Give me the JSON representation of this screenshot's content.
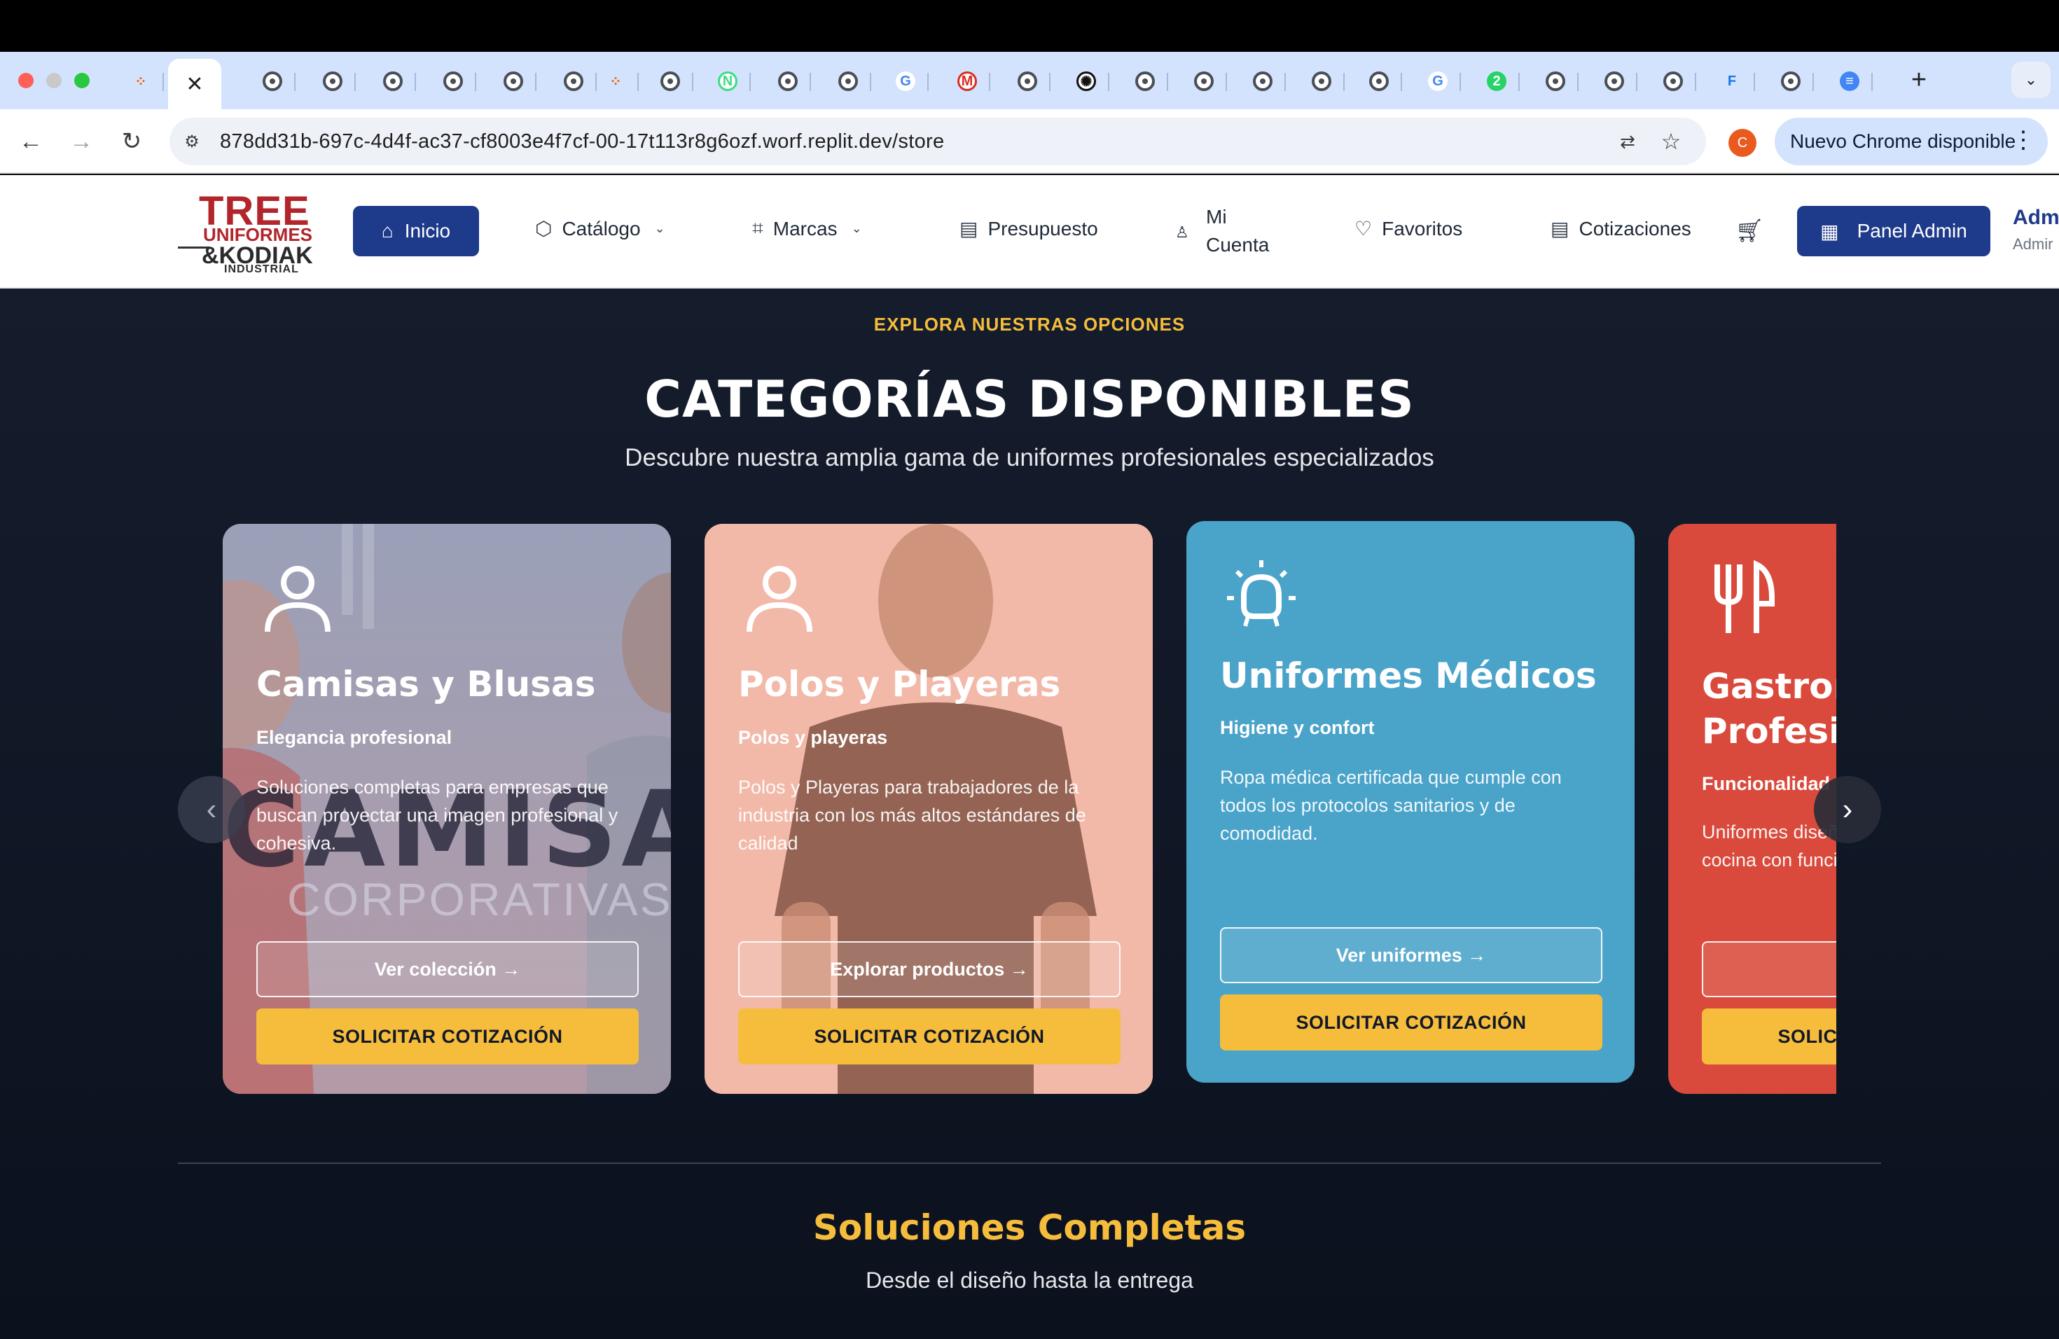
{
  "browser": {
    "active_tab_close": "✕",
    "new_tab": "+",
    "tab_menu": "⌄",
    "url": "878dd31b-697c-4d4f-ac37-cf8003e4f7cf-00-17t113r8g6ozf.worf.replit.dev/store",
    "profile_initial": "C",
    "update_label": "Nuevo Chrome disponible",
    "tabs": [
      {
        "icon": "replit-icon",
        "glyph": "⁘"
      },
      {
        "icon": "globe-icon",
        "glyph": ""
      },
      {
        "icon": "globe-icon",
        "glyph": ""
      },
      {
        "icon": "globe-icon",
        "glyph": ""
      },
      {
        "icon": "globe-icon",
        "glyph": ""
      },
      {
        "icon": "globe-icon",
        "glyph": ""
      },
      {
        "icon": "globe-icon",
        "glyph": ""
      },
      {
        "icon": "replit-icon",
        "glyph": "⁘"
      },
      {
        "icon": "globe-icon",
        "glyph": ""
      },
      {
        "icon": "n-icon",
        "glyph": "N"
      },
      {
        "icon": "globe-icon",
        "glyph": ""
      },
      {
        "icon": "globe-icon",
        "glyph": ""
      },
      {
        "icon": "google-icon",
        "glyph": "G"
      },
      {
        "icon": "m-icon",
        "glyph": "M"
      },
      {
        "icon": "globe-icon",
        "glyph": ""
      },
      {
        "icon": "openai-icon",
        "glyph": "✺"
      },
      {
        "icon": "globe-icon",
        "glyph": ""
      },
      {
        "icon": "globe-icon",
        "glyph": ""
      },
      {
        "icon": "globe-icon",
        "glyph": ""
      },
      {
        "icon": "globe-icon",
        "glyph": ""
      },
      {
        "icon": "globe-icon",
        "glyph": ""
      },
      {
        "icon": "google-icon",
        "glyph": "G"
      },
      {
        "icon": "whatsapp-icon",
        "glyph": "2"
      },
      {
        "icon": "globe-icon",
        "glyph": ""
      },
      {
        "icon": "globe-icon",
        "glyph": ""
      },
      {
        "icon": "globe-icon",
        "glyph": ""
      },
      {
        "icon": "f-icon",
        "glyph": "F"
      },
      {
        "icon": "globe-icon",
        "glyph": ""
      },
      {
        "icon": "docs-icon",
        "glyph": "≡"
      }
    ]
  },
  "header": {
    "logo": {
      "line1": "TREE",
      "line2": "UNIFORMES",
      "line3": "&KODIAK",
      "line4": "INDUSTRIAL"
    },
    "nav": {
      "inicio": "Inicio",
      "catalogo": "Catálogo",
      "marcas": "Marcas",
      "presupuesto": "Presupuesto",
      "mi": "Mi",
      "cuenta": "Cuenta",
      "favoritos": "Favoritos",
      "cotizaciones": "Cotizaciones"
    },
    "panel_admin": "Panel Admin",
    "admin_name": "Adm",
    "admin_role": "Admir"
  },
  "section": {
    "eyebrow": "EXPLORA NUESTRAS OPCIONES",
    "title": "CATEGORÍAS DISPONIBLES",
    "subtitle": "Descubre nuestra amplia gama de uniformes profesionales especializados"
  },
  "cards": [
    {
      "title": "Camisas y Blusas",
      "tagline": "Elegancia profesional",
      "description": "Soluciones completas para empresas que buscan proyectar una imagen profesional y cohesiva.",
      "bg_word1": "CAMISA",
      "bg_word2": "CORPORATIVAS",
      "outline_button": "Ver colección →",
      "quote_button": "SOLICITAR COTIZACIÓN",
      "color": "#8d93ad"
    },
    {
      "title": "Polos y Playeras",
      "tagline": "Polos y playeras",
      "description": "Polos y Playeras para trabajadores de la industria con los más altos estándares de calidad",
      "outline_button": "Explorar productos →",
      "quote_button": "SOLICITAR COTIZACIÓN",
      "color": "#f2b8a8"
    },
    {
      "title": "Uniformes Médicos",
      "tagline": "Higiene y confort",
      "description": "Ropa médica certificada que cumple con todos los protocolos sanitarios y de comodidad.",
      "outline_button": "Ver uniformes →",
      "quote_button": "SOLICITAR COTIZACIÓN",
      "color": "#4aa3c9"
    },
    {
      "title": "Gastronomía Profesional",
      "tagline": "Funcionalidad",
      "description": "Uniformes diseñados para chefs y personal de cocina con funcionalidad.",
      "outline_button": "",
      "quote_button": "SOLICITAR COTIZACIÓN",
      "color": "#d94a3c"
    }
  ],
  "carousel": {
    "prev": "‹",
    "next": "›"
  },
  "solutions": {
    "title": "Soluciones Completas",
    "subtitle": "Desde el diseño hasta la entrega"
  },
  "colors": {
    "accent_yellow": "#f6bd3c",
    "brand_blue": "#1e3a8a",
    "dark_bg": "#121a29",
    "logo_red": "#b1252b"
  }
}
